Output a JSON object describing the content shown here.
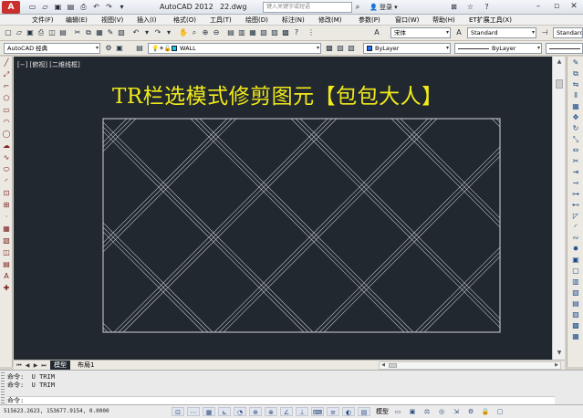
{
  "app": {
    "logo": "A",
    "title": "AutoCAD 2012",
    "file": "22.dwg",
    "search_placeholder": "键入关键字或短语",
    "login_label": "登录"
  },
  "menu": [
    "文件(F)",
    "编辑(E)",
    "视图(V)",
    "插入(I)",
    "格式(O)",
    "工具(T)",
    "绘图(D)",
    "标注(N)",
    "修改(M)",
    "参数(P)",
    "窗口(W)",
    "帮助(H)",
    "ET扩展工具(X)"
  ],
  "toolbar": {
    "workspace": "AutoCAD 经典",
    "layer": "WALL",
    "font": "宋体",
    "text_style": "Standard",
    "text_style_right": "Standard",
    "color": "ByLayer",
    "linetype": "ByLayer"
  },
  "viewport": {
    "label": "[−] [俯视] [二维线框]",
    "overlay_title": "TR栏选模式修剪图元【包包大人】"
  },
  "tabs": {
    "model": "模型",
    "layout1": "布局1"
  },
  "command": {
    "line1": "命令:  U TRIM",
    "line2": "命令:  U TRIM",
    "prompt": "命令:"
  },
  "status": {
    "coords": "515623.2623, 153677.9154, 0.0000",
    "model_label": "模型"
  },
  "colors": {
    "canvas": "#212830",
    "title_yellow": "#f2ea1a",
    "lines": "#c8cdd2"
  }
}
